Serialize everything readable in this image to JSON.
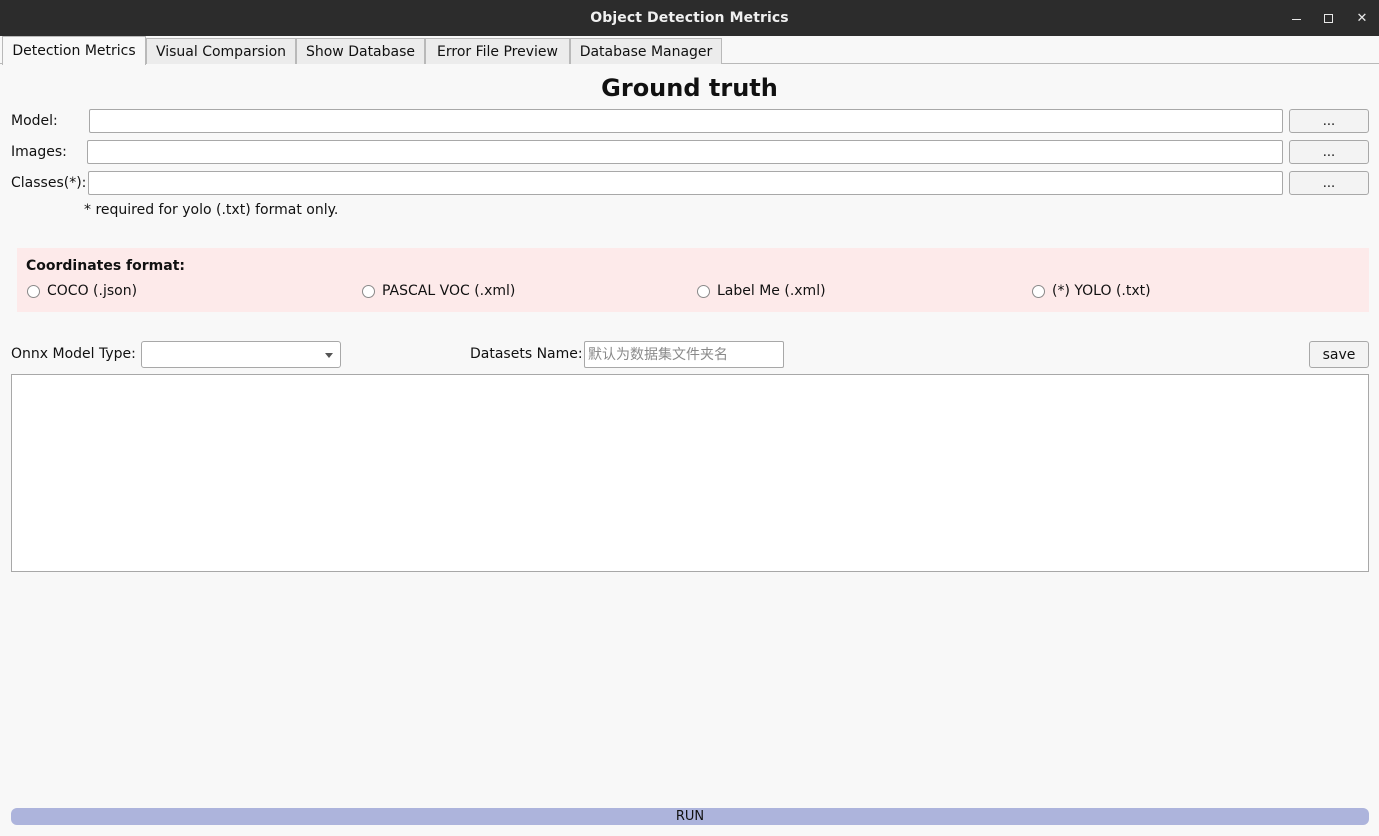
{
  "window": {
    "title": "Object Detection Metrics",
    "minimize_glyph": "",
    "close_glyph": "✕"
  },
  "tabs": [
    {
      "label": "Detection Metrics",
      "active": true
    },
    {
      "label": "Visual Comparsion",
      "active": false
    },
    {
      "label": "Show Database",
      "active": false
    },
    {
      "label": "Error File Preview",
      "active": false
    },
    {
      "label": "Database Manager",
      "active": false
    }
  ],
  "ground_truth": {
    "heading": "Ground truth",
    "fields": [
      {
        "label": "Model:",
        "value": "",
        "browse_label": "..."
      },
      {
        "label": "Images:",
        "value": "",
        "browse_label": "..."
      },
      {
        "label": "Classes(*):",
        "value": "",
        "browse_label": "..."
      }
    ],
    "note": "* required for yolo (.txt) format only."
  },
  "coordinates_format": {
    "title": "Coordinates format:",
    "options": [
      {
        "label": "COCO (.json)",
        "checked": false
      },
      {
        "label": "PASCAL VOC (.xml)",
        "checked": false
      },
      {
        "label": "Label Me (.xml)",
        "checked": false
      },
      {
        "label": "(*) YOLO (.txt)",
        "checked": false
      }
    ]
  },
  "onnx": {
    "label": "Onnx Model Type:",
    "selected": ""
  },
  "datasets": {
    "label": "Datasets Name:",
    "placeholder": "默认为数据集文件夹名",
    "value": ""
  },
  "save_label": "save",
  "log_text": "",
  "run_label": "RUN",
  "colors": {
    "titlebar": "#2c2c2c",
    "coord_group_bg": "#fdeaea",
    "run_button": "#adb4dc"
  }
}
